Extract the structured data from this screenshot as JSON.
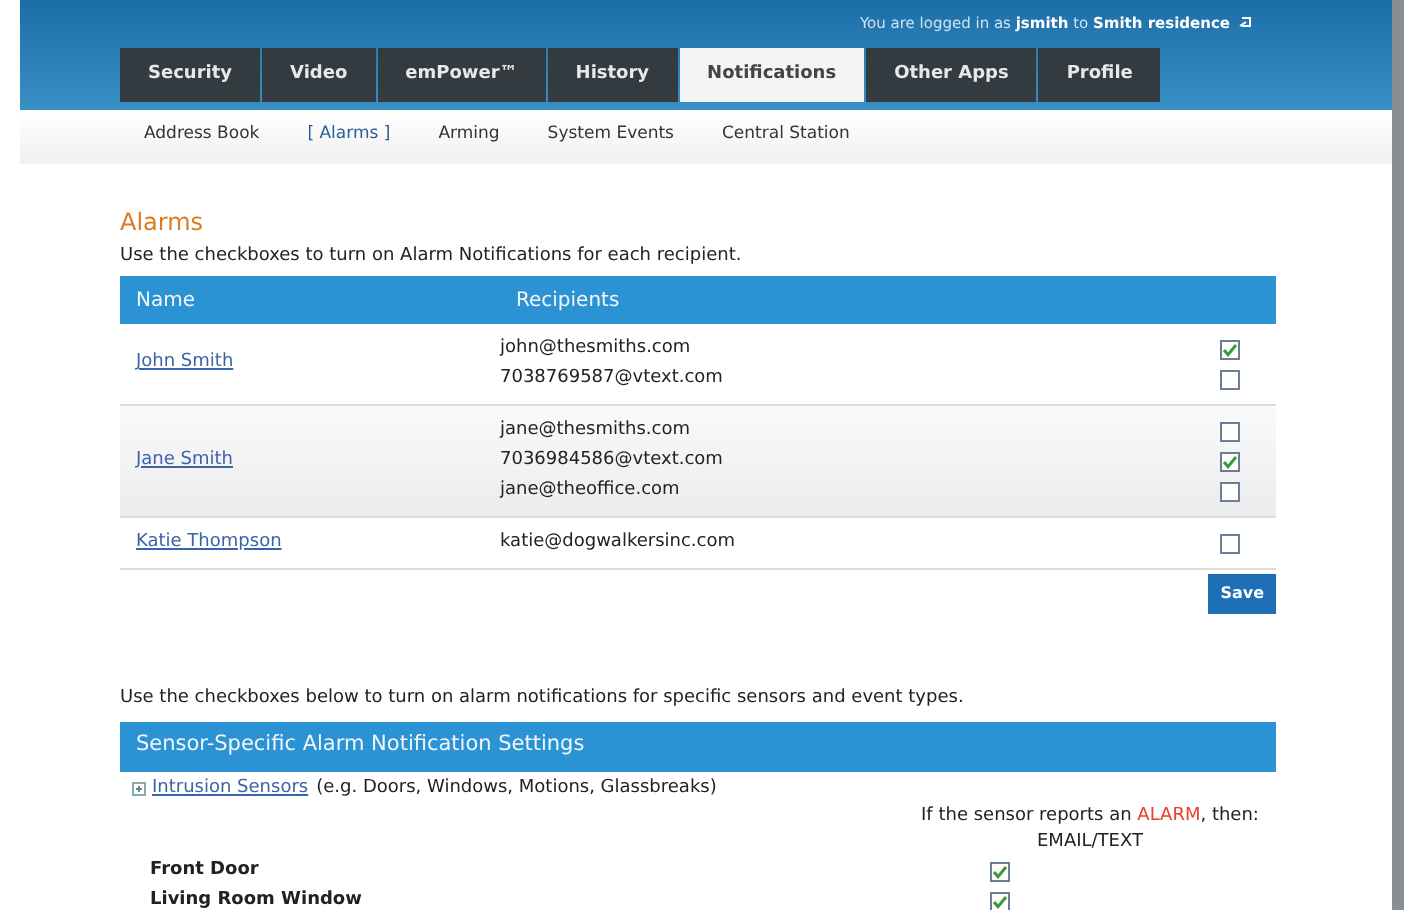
{
  "header": {
    "login_prefix": "You are logged in as",
    "user": "jsmith",
    "login_middle": "to",
    "site": "Smith residence"
  },
  "tabs": [
    {
      "label": "Security",
      "selected": false
    },
    {
      "label": "Video",
      "selected": false
    },
    {
      "label": "emPower™",
      "selected": false
    },
    {
      "label": "History",
      "selected": false
    },
    {
      "label": "Notifications",
      "selected": true
    },
    {
      "label": "Other Apps",
      "selected": false
    },
    {
      "label": "Profile",
      "selected": false
    }
  ],
  "subnav": [
    {
      "label": "Address Book",
      "selected": false
    },
    {
      "label": "[ Alarms ]",
      "selected": true
    },
    {
      "label": "Arming",
      "selected": false
    },
    {
      "label": "System Events",
      "selected": false
    },
    {
      "label": "Central Station",
      "selected": false
    }
  ],
  "alarms": {
    "title": "Alarms",
    "instructions": "Use the checkboxes to turn on Alarm Notifications for each recipient.",
    "columns": [
      "Name",
      "Recipients"
    ],
    "people": [
      {
        "name": "John Smith",
        "recipients": [
          {
            "address": "john@thesmiths.com",
            "checked": true
          },
          {
            "address": "7038769587@vtext.com",
            "checked": false
          }
        ]
      },
      {
        "name": "Jane Smith",
        "recipients": [
          {
            "address": "jane@thesmiths.com",
            "checked": false
          },
          {
            "address": "7036984586@vtext.com",
            "checked": true
          },
          {
            "address": "jane@theoffice.com",
            "checked": false
          }
        ]
      },
      {
        "name": "Katie Thompson",
        "recipients": [
          {
            "address": "katie@dogwalkersinc.com",
            "checked": false
          }
        ]
      }
    ],
    "save": "Save"
  },
  "sensors": {
    "instructions": "Use the checkboxes below to turn on alarm notifications for specific sensors and event types.",
    "title": "Sensor-Specific Alarm Notification Settings",
    "group_link": "Intrusion Sensors",
    "group_note": "(e.g. Doors, Windows, Motions, Glassbreaks)",
    "prompt": {
      "before": "If the sensor reports an ",
      "highlight": "ALARM",
      "after": ", then:"
    },
    "column": "EMAIL/TEXT",
    "items": [
      {
        "name": "Front Door",
        "checked": true
      },
      {
        "name": "Living Room Window",
        "checked": true
      }
    ]
  }
}
